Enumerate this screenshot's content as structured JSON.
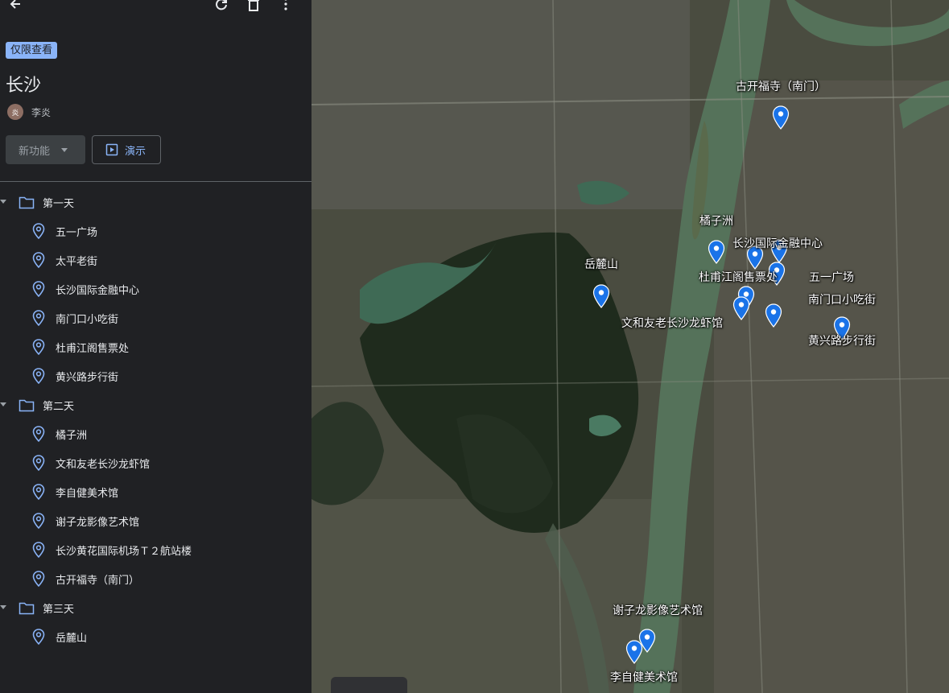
{
  "badge": "仅限查看",
  "title": "长沙",
  "author": {
    "name": "李炎",
    "avatar_initial": "炎"
  },
  "buttons": {
    "feature": "新功能",
    "present": "演示"
  },
  "folders": [
    {
      "label": "第一天",
      "items": [
        "五一广场",
        "太平老街",
        "长沙国际金融中心",
        "南门口小吃街",
        "杜甫江阁售票处",
        "黄兴路步行街"
      ]
    },
    {
      "label": "第二天",
      "items": [
        "橘子洲",
        "文和友老长沙龙虾馆",
        "李自健美术馆",
        "谢子龙影像艺术馆",
        "长沙黄花国际机场Ｔ２航站楼",
        "古开福寺（南门）"
      ]
    },
    {
      "label": "第三天",
      "items": [
        "岳麓山"
      ]
    }
  ],
  "map_labels": {
    "kaifu": "古开福寺（南门）",
    "juzizhou": "橘子洲",
    "ifc": "长沙国际金融中心",
    "yuelu": "岳麓山",
    "dufu": "杜甫江阁售票处",
    "wuyi": "五一广场",
    "nanmenkou": "南门口小吃街",
    "wenheyou": "文和友老长沙龙虾馆",
    "huangxing": "黄兴路步行街",
    "xiezilong": "谢子龙影像艺术馆",
    "lizijian": "李自健美术馆"
  },
  "colors": {
    "accent": "#8ab4f8",
    "marker": "#1a73e8",
    "sidebar_bg": "#202124",
    "river": "#55725a"
  },
  "icons": {
    "back": "arrow-left-icon",
    "refresh": "refresh-icon",
    "delete": "trash-icon",
    "more": "more-vert-icon",
    "folder": "folder-icon",
    "place": "location-pin-icon",
    "present": "slideshow-icon"
  }
}
